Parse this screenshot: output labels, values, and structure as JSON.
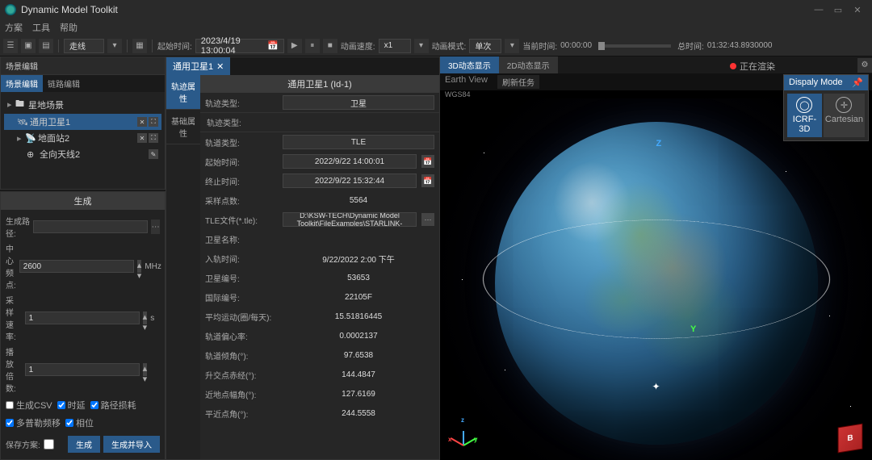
{
  "app": {
    "title": "Dynamic Model Toolkit"
  },
  "menu": [
    "方案",
    "工具",
    "帮助"
  ],
  "toolbar": {
    "mode_label": "走线",
    "start_label": "起始时间:",
    "start_value": "2023/4/19 13:00:04",
    "speed_label": "动画速度:",
    "speed_value": "x1",
    "anim_mode_label": "动画模式:",
    "anim_mode_value": "单次",
    "current_label": "当前时间:",
    "current_value": "00:00:00",
    "total_label": "总时间:",
    "total_value": "01:32:43.8930000"
  },
  "scene_panel": {
    "title": "场景编辑",
    "tabs": {
      "scene": "场景编辑",
      "link": "链路编辑"
    },
    "tree": {
      "root": "星地场景",
      "sat": "通用卫星1",
      "station": "地面站2",
      "antenna": "全向天线2"
    }
  },
  "gen": {
    "title": "生成",
    "path_label": "生成路径:",
    "center_label": "中心频点:",
    "center_value": "2600",
    "center_unit": "MHz",
    "rate_label": "采样速率:",
    "rate_value": "1",
    "rate_unit": "s",
    "mult_label": "播放倍数:",
    "mult_value": "1",
    "checks": {
      "csv": "生成CSV",
      "time": "时延",
      "doppler": "路径损耗",
      "multi": "多普勒频移",
      "phase": "相位"
    },
    "save_label": "保存方案:",
    "btn_gen": "生成",
    "btn_gen_import": "生成并导入"
  },
  "props": {
    "tab": "通用卫星1",
    "side_tabs": {
      "orbit": "轨迹属性",
      "basic": "基础属性"
    },
    "header": "通用卫星1 (Id-1)",
    "rows": {
      "track_type_label": "轨迹类型:",
      "track_type": "卫星",
      "orbit_type_label": "轨道类型:",
      "orbit_type": "TLE",
      "start_label": "起始时间:",
      "start": "2022/9/22 14:00:01",
      "end_label": "终止时间:",
      "end": "2022/9/22 15:32:44",
      "samples_label": "采样点数:",
      "samples": "5564",
      "tle_label": "TLE文件(*.tle):",
      "tle": "D:\\KSW-TECH\\Dynamic Model Toolkit\\FileExamples\\STARLINK-",
      "satname_label": "卫星名称:",
      "epoch_label": "入轨时间:",
      "epoch": "9/22/2022 2:00 下午",
      "satnum_label": "卫星编号:",
      "satnum": "53653",
      "intl_label": "国际编号:",
      "intl": "22105F",
      "motion_label": "平均运动(圈/每天):",
      "motion": "15.51816445",
      "ecc_label": "轨道偏心率:",
      "ecc": "0.0002137",
      "incl_label": "轨道倾角(°):",
      "incl": "97.6538",
      "raan_label": "升交点赤经(°):",
      "raan": "144.4847",
      "perigee_label": "近地点幅角(°):",
      "perigee": "127.6169",
      "anomaly_label": "平近点角(°):",
      "anomaly": "244.5558"
    }
  },
  "view": {
    "tabs": {
      "d3": "3D动态显示",
      "d2": "2D动态显示",
      "refresh": "刷新任务"
    },
    "earth_view": "Earth View",
    "wgs": "WGS84",
    "status": "正在渲染",
    "display_mode": {
      "title": "Dispaly Mode",
      "icrf": "ICRF-3D",
      "cart": "Cartesian"
    },
    "axes": {
      "x": "X",
      "y": "Y",
      "z": "Z"
    },
    "cube": "B"
  }
}
